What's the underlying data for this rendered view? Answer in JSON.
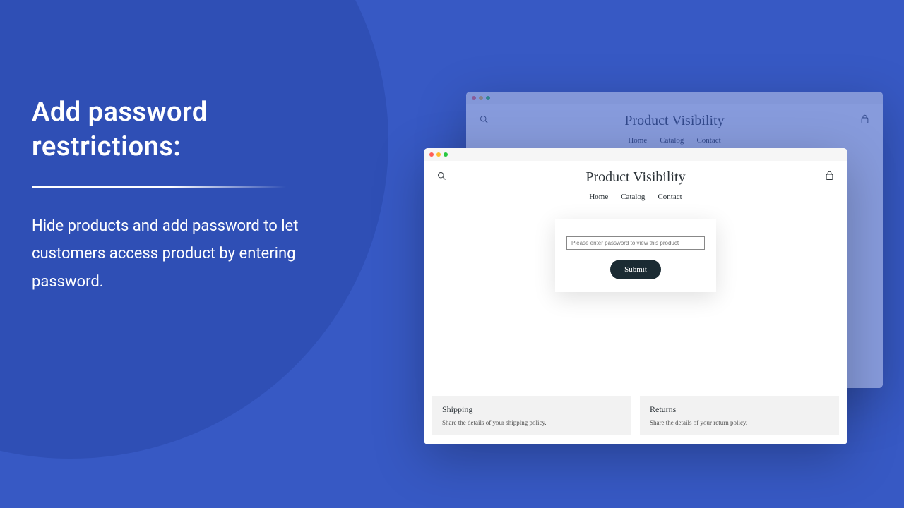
{
  "marketing": {
    "headline": "Add password restrictions:",
    "body": "Hide products and add password to let customers access product by entering password."
  },
  "store": {
    "title": "Product Visibility",
    "nav": {
      "home": "Home",
      "catalog": "Catalog",
      "contact": "Contact"
    }
  },
  "password_card": {
    "placeholder": "Please enter password to view this product",
    "submit": "Submit"
  },
  "policies": {
    "shipping": {
      "title": "Shipping",
      "text": "Share the details of your shipping policy."
    },
    "returns": {
      "title": "Returns",
      "text": "Share the details of your return policy."
    }
  }
}
